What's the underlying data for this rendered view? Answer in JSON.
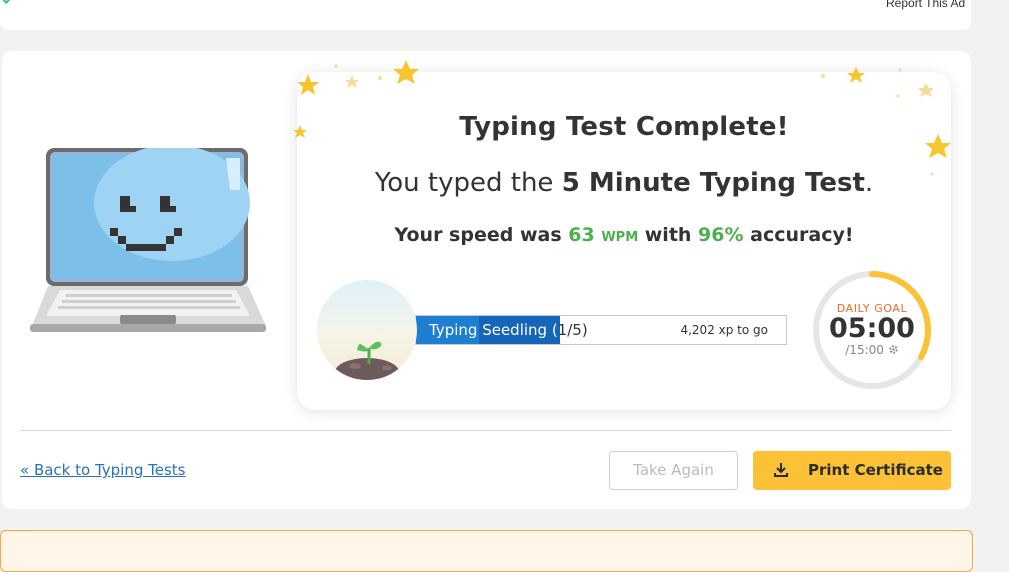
{
  "top_bar": {
    "report_ad": "Report This Ad"
  },
  "result": {
    "title": "Typing Test Complete!",
    "subtitle_prefix": "You typed the ",
    "test_name": "5 Minute Typing Test",
    "subtitle_suffix": ".",
    "speed_prefix": "Your speed was ",
    "wpm": "63",
    "wpm_unit": "WPM",
    "speed_mid": " with ",
    "accuracy": "96%",
    "speed_suffix": " accuracy!"
  },
  "level": {
    "name_highlighted": "Typing Seedling (",
    "name_rest": "1/5)",
    "xp_to_go": "4,202 xp to go",
    "progress_fraction": 0.39
  },
  "daily_goal": {
    "label": "DAILY GOAL",
    "time": "05:00",
    "total": "/15:00",
    "progress_fraction": 0.33
  },
  "actions": {
    "back_link": "« Back to Typing Tests",
    "take_again": "Take Again",
    "print_certificate": "Print Certificate"
  },
  "icons": {
    "laptop": "smiling-laptop-icon",
    "seedling": "seedling-icon",
    "gear": "gear-icon",
    "download": "download-icon",
    "star": "star-icon"
  },
  "colors": {
    "accent_green": "#4caf50",
    "progress_blue": "#1e7ed2",
    "goal_yellow": "#fcc237",
    "goal_label_orange": "#f0672a",
    "link_blue": "#2a72b8"
  }
}
